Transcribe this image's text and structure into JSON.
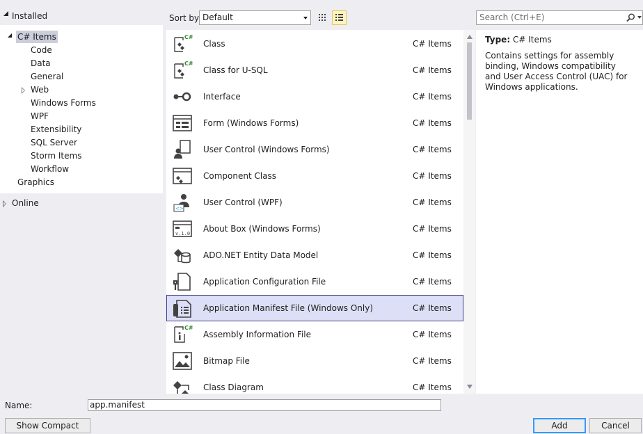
{
  "tree": {
    "installed": "Installed",
    "csharp_items": "C# Items",
    "children": [
      "Code",
      "Data",
      "General",
      "Web",
      "Windows Forms",
      "WPF",
      "Extensibility",
      "SQL Server",
      "Storm Items",
      "Workflow"
    ],
    "graphics": "Graphics",
    "online": "Online"
  },
  "toolbar": {
    "sort_label": "Sort by:",
    "sort_value": "Default",
    "search_placeholder": "Search (Ctrl+E)"
  },
  "items": [
    {
      "name": "Class",
      "lang": "C# Items",
      "icon": "class-icon"
    },
    {
      "name": "Class for U-SQL",
      "lang": "C# Items",
      "icon": "class-usql-icon"
    },
    {
      "name": "Interface",
      "lang": "C# Items",
      "icon": "interface-icon"
    },
    {
      "name": "Form (Windows Forms)",
      "lang": "C# Items",
      "icon": "form-icon"
    },
    {
      "name": "User Control (Windows Forms)",
      "lang": "C# Items",
      "icon": "user-control-icon"
    },
    {
      "name": "Component Class",
      "lang": "C# Items",
      "icon": "component-icon"
    },
    {
      "name": "User Control (WPF)",
      "lang": "C# Items",
      "icon": "wpf-user-control-icon"
    },
    {
      "name": "About Box (Windows Forms)",
      "lang": "C# Items",
      "icon": "about-box-icon"
    },
    {
      "name": "ADO.NET Entity Data Model",
      "lang": "C# Items",
      "icon": "entity-model-icon"
    },
    {
      "name": "Application Configuration File",
      "lang": "C# Items",
      "icon": "config-file-icon"
    },
    {
      "name": "Application Manifest File (Windows Only)",
      "lang": "C# Items",
      "icon": "manifest-file-icon"
    },
    {
      "name": "Assembly Information File",
      "lang": "C# Items",
      "icon": "assembly-info-icon"
    },
    {
      "name": "Bitmap File",
      "lang": "C# Items",
      "icon": "bitmap-icon"
    },
    {
      "name": "Class Diagram",
      "lang": "C# Items",
      "icon": "class-diagram-icon"
    }
  ],
  "details": {
    "type_label": "Type:",
    "type_value": "C# Items",
    "description": "Contains settings for assembly binding, Windows compatibility and User Access Control (UAC) for Windows applications."
  },
  "bottom": {
    "name_label": "Name:",
    "name_value": "app.manifest",
    "compact_view": "Show Compact View",
    "add": "Add",
    "cancel": "Cancel"
  },
  "colors": {
    "selected_bg": "#dcdff5",
    "selected_border": "#3e3e8e",
    "tree_selected": "#cccedb",
    "accent": "#3399ff"
  }
}
